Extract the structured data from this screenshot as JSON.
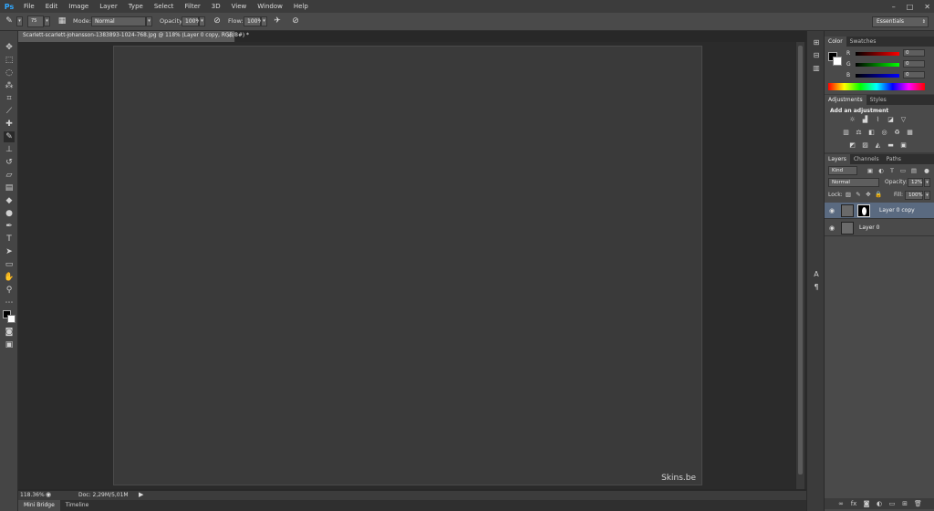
{
  "app": {
    "logo": "Ps"
  },
  "menu": [
    "File",
    "Edit",
    "Image",
    "Layer",
    "Type",
    "Select",
    "Filter",
    "3D",
    "View",
    "Window",
    "Help"
  ],
  "window_controls": {
    "minimize": "–",
    "maximize": "□",
    "close": "✕"
  },
  "options": {
    "brush_size": "75",
    "mode_label": "Mode:",
    "mode_value": "Normal",
    "opacity_label": "Opacity:",
    "opacity_value": "100%",
    "flow_label": "Flow:",
    "flow_value": "100%",
    "workspace": "Essentials"
  },
  "document": {
    "tab_title": "Scarlett-scarlett-johansson-1383893-1024-768.jpg @ 118% (Layer 0 copy, RGB/8#) *",
    "close": "×",
    "watermark": "Skins.be"
  },
  "status": {
    "zoom": "118.36%",
    "doc_size": "Doc: 2,29M/5,01M",
    "arrow": "▶"
  },
  "bottom_tabs": [
    "Mini Bridge",
    "Timeline"
  ],
  "color_panel": {
    "tabs": [
      "Color",
      "Swatches"
    ],
    "sliders": [
      {
        "label": "R",
        "value": "0"
      },
      {
        "label": "G",
        "value": "0"
      },
      {
        "label": "B",
        "value": "0"
      }
    ]
  },
  "adjustments_panel": {
    "tabs": [
      "Adjustments",
      "Styles"
    ],
    "title": "Add an adjustment"
  },
  "layers_panel": {
    "tabs": [
      "Layers",
      "Channels",
      "Paths"
    ],
    "filter": "Kind",
    "blend_mode": "Normal",
    "opacity_label": "Opacity:",
    "opacity_value": "12%",
    "lock_label": "Lock:",
    "fill_label": "Fill:",
    "fill_value": "100%",
    "layers": [
      {
        "name": "Layer 0 copy",
        "selected": true,
        "has_mask": true
      },
      {
        "name": "Layer 0",
        "selected": false,
        "has_mask": false
      }
    ]
  },
  "colors": {
    "accent": "#31a8ff",
    "selected_layer": "#5a6a80"
  }
}
